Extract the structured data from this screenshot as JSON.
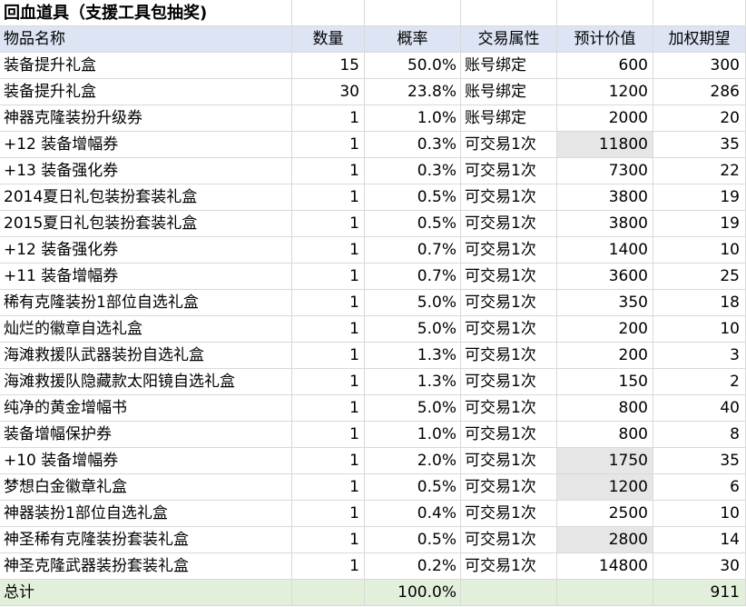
{
  "sheet": {
    "title": "回血道具（支援工具包抽奖)",
    "headers": [
      "物品名称",
      "数量",
      "概率",
      "交易属性",
      "预计价值",
      "加权期望"
    ],
    "rows": [
      {
        "name": "装备提升礼盒",
        "qty": "15",
        "prob": "50.0%",
        "trade": "账号绑定",
        "value": "600",
        "expect": "300"
      },
      {
        "name": "装备提升礼盒",
        "qty": "30",
        "prob": "23.8%",
        "trade": "账号绑定",
        "value": "1200",
        "expect": "286"
      },
      {
        "name": "神器克隆装扮升级券",
        "qty": "1",
        "prob": "1.0%",
        "trade": "账号绑定",
        "value": "2000",
        "expect": "20"
      },
      {
        "name": "+12 装备增幅券",
        "qty": "1",
        "prob": "0.3%",
        "trade": "可交易1次",
        "value": "11800",
        "expect": "35",
        "highlight": true
      },
      {
        "name": "+13 装备强化券",
        "qty": "1",
        "prob": "0.3%",
        "trade": "可交易1次",
        "value": "7300",
        "expect": "22"
      },
      {
        "name": "2014夏日礼包装扮套装礼盒",
        "qty": "1",
        "prob": "0.5%",
        "trade": "可交易1次",
        "value": "3800",
        "expect": "19"
      },
      {
        "name": "2015夏日礼包装扮套装礼盒",
        "qty": "1",
        "prob": "0.5%",
        "trade": "可交易1次",
        "value": "3800",
        "expect": "19"
      },
      {
        "name": "+12 装备强化券",
        "qty": "1",
        "prob": "0.7%",
        "trade": "可交易1次",
        "value": "1400",
        "expect": "10"
      },
      {
        "name": "+11 装备增幅券",
        "qty": "1",
        "prob": "0.7%",
        "trade": "可交易1次",
        "value": "3600",
        "expect": "25"
      },
      {
        "name": "稀有克隆装扮1部位自选礼盒",
        "qty": "1",
        "prob": "5.0%",
        "trade": "可交易1次",
        "value": "350",
        "expect": "18"
      },
      {
        "name": "灿烂的徽章自选礼盒",
        "qty": "1",
        "prob": "5.0%",
        "trade": "可交易1次",
        "value": "200",
        "expect": "10"
      },
      {
        "name": "海滩救援队武器装扮自选礼盒",
        "qty": "1",
        "prob": "1.3%",
        "trade": "可交易1次",
        "value": "200",
        "expect": "3"
      },
      {
        "name": "海滩救援队隐藏款太阳镜自选礼盒",
        "qty": "1",
        "prob": "1.3%",
        "trade": "可交易1次",
        "value": "150",
        "expect": "2"
      },
      {
        "name": "纯净的黄金增幅书",
        "qty": "1",
        "prob": "5.0%",
        "trade": "可交易1次",
        "value": "800",
        "expect": "40"
      },
      {
        "name": "装备增幅保护券",
        "qty": "1",
        "prob": "1.0%",
        "trade": "可交易1次",
        "value": "800",
        "expect": "8"
      },
      {
        "name": "+10 装备增幅券",
        "qty": "1",
        "prob": "2.0%",
        "trade": "可交易1次",
        "value": "1750",
        "expect": "35",
        "highlight": true
      },
      {
        "name": "梦想白金徽章礼盒",
        "qty": "1",
        "prob": "0.5%",
        "trade": "可交易1次",
        "value": "1200",
        "expect": "6",
        "highlight": true
      },
      {
        "name": "神器装扮1部位自选礼盒",
        "qty": "1",
        "prob": "0.4%",
        "trade": "可交易1次",
        "value": "2500",
        "expect": "10"
      },
      {
        "name": "神圣稀有克隆装扮套装礼盒",
        "qty": "1",
        "prob": "0.5%",
        "trade": "可交易1次",
        "value": "2800",
        "expect": "14",
        "highlight": true
      },
      {
        "name": "神圣克隆武器装扮套装礼盒",
        "qty": "1",
        "prob": "0.2%",
        "trade": "可交易1次",
        "value": "14800",
        "expect": "30"
      }
    ],
    "total": {
      "label": "总计",
      "qty": "",
      "prob": "100.0%",
      "trade": "",
      "value": "",
      "expect": "911"
    },
    "colors": {
      "header_bg": "#dde4f4",
      "total_bg": "#e2efda",
      "highlight_bg": "#e7e6e6",
      "grid": "#d9d9d9"
    }
  }
}
